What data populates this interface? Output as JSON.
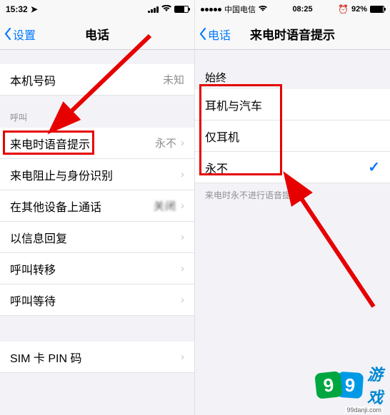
{
  "left": {
    "status": {
      "time": "15:32",
      "carrier": "",
      "signal": 4,
      "battery_pct": 70
    },
    "nav": {
      "back": "设置",
      "title": "电话"
    },
    "rows": {
      "my_number": {
        "label": "本机号码",
        "value": "未知"
      },
      "section_call": "呼叫",
      "announce": {
        "label": "来电时语音提示",
        "value": "永不"
      },
      "block": {
        "label": "来电阻止与身份识别",
        "value": ""
      },
      "other_devices": {
        "label": "在其他设备上通话",
        "value": "关闭"
      },
      "reply_msg": {
        "label": "以信息回复",
        "value": ""
      },
      "forward": {
        "label": "呼叫转移",
        "value": ""
      },
      "waiting": {
        "label": "呼叫等待",
        "value": ""
      },
      "sim_pin": {
        "label": "SIM 卡 PIN 码",
        "value": ""
      }
    }
  },
  "right": {
    "status": {
      "time": "08:25",
      "carrier": "中国电信",
      "battery_pct": 92,
      "battery_text": "92%"
    },
    "nav": {
      "back": "电话",
      "title": "来电时语音提示"
    },
    "section": "始终",
    "options": {
      "opt1": "耳机与汽车",
      "opt2": "仅耳机",
      "opt3": "永不"
    },
    "selected": "opt3",
    "footer": "来电时永不进行语音提示。"
  },
  "watermark": {
    "brand": "游戏",
    "url": "99danji.com"
  }
}
